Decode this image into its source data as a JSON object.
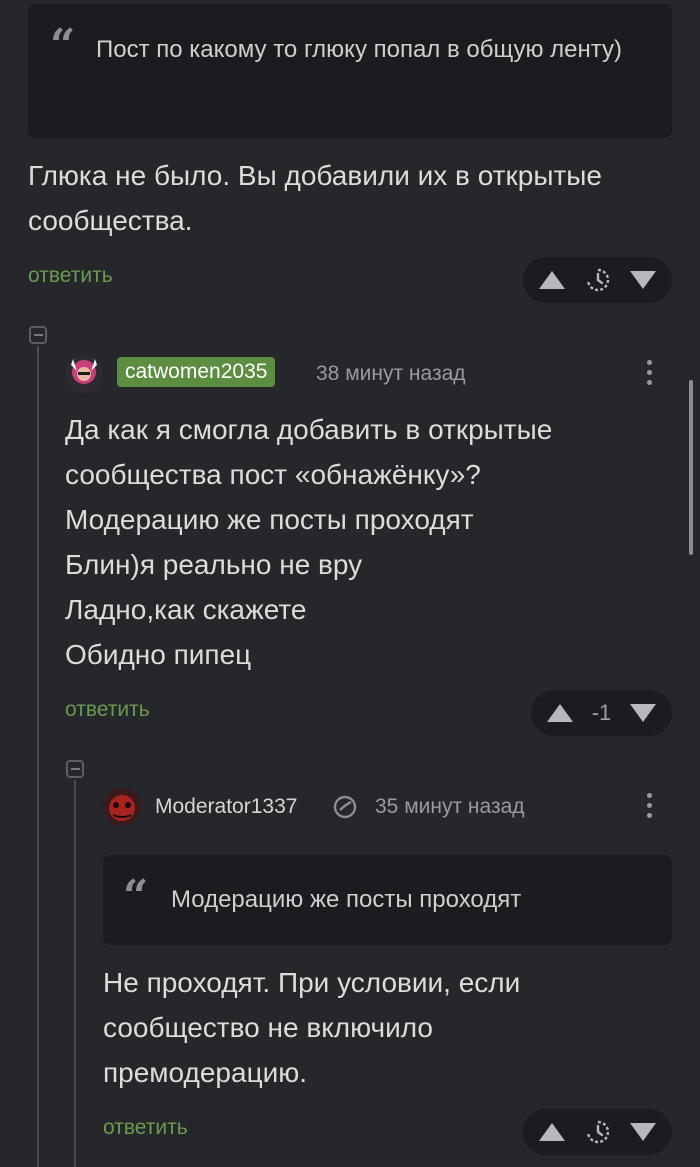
{
  "top_quote": {
    "text": "Пост по какому то глюку попал в общую ленту)"
  },
  "first_comment": {
    "lines": [
      "Глюка не было. Вы добавили их в открытые",
      "сообщества."
    ],
    "reply_label": "ответить",
    "score_icon": "clock-timer-icon"
  },
  "comment_catwomen": {
    "username": "catwomen2035",
    "time": "38 минут назад",
    "lines": [
      "Да как я смогла добавить в открытые",
      "сообщества пост «обнажёнку»?",
      "Модерацию же посты проходят",
      "Блин)я реально не вру",
      "Ладно,как скажете",
      "Обидно пипец"
    ],
    "reply_label": "ответить",
    "score": "-1",
    "badge_color": "#5c8d40"
  },
  "comment_moderator": {
    "username": "Moderator1337",
    "time": "35 минут назад",
    "quote": "Модерацию же посты проходят",
    "lines": [
      "Не проходят. При условии, если",
      "сообщество не включило",
      "премодерацию."
    ],
    "reply_label": "ответить",
    "score_icon": "clock-timer-icon"
  },
  "colors": {
    "background": "#26272b",
    "accent": "#6a9a4e",
    "quote_bg": "#1b1c1f"
  }
}
